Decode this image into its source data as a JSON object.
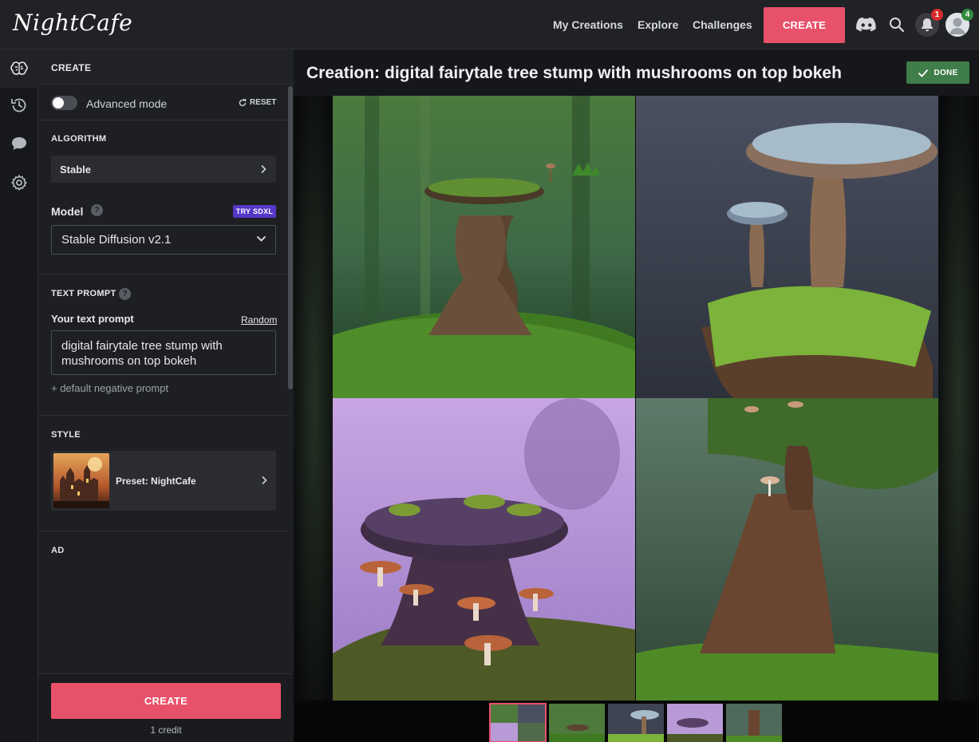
{
  "app": {
    "logo_text": "NightCafe"
  },
  "topnav": {
    "links": [
      "My Creations",
      "Explore",
      "Challenges"
    ],
    "create_label": "CREATE",
    "notifications_count": "1",
    "avatar_badge": "4"
  },
  "rail": {
    "icons": [
      "brain-icon",
      "history-icon",
      "chat-icon",
      "gear-icon"
    ]
  },
  "panel": {
    "header": "CREATE",
    "advanced_mode_label": "Advanced mode",
    "advanced_mode_on": false,
    "reset_label": "RESET",
    "algorithm": {
      "title": "ALGORITHM",
      "value": "Stable"
    },
    "model": {
      "label": "Model",
      "try_label": "TRY SDXL",
      "value": "Stable Diffusion v2.1"
    },
    "prompt": {
      "title": "TEXT PROMPT",
      "label": "Your text prompt",
      "random_label": "Random",
      "value": "digital fairytale tree stump with mushrooms on top bokeh",
      "negative_label": "+ default negative prompt"
    },
    "style": {
      "title": "STYLE",
      "value": "Preset: NightCafe"
    },
    "ad_title": "AD",
    "create_label": "CREATE",
    "credit_text": "1 credit"
  },
  "main": {
    "title": "Creation: digital fairytale tree stump with mushrooms on top bokeh",
    "done_label": "DONE"
  },
  "colors": {
    "accent": "#e8516a",
    "done_green": "#3f7d4a",
    "sdxl_purple": "#5637c8",
    "panel_bg": "#1d1f22"
  }
}
